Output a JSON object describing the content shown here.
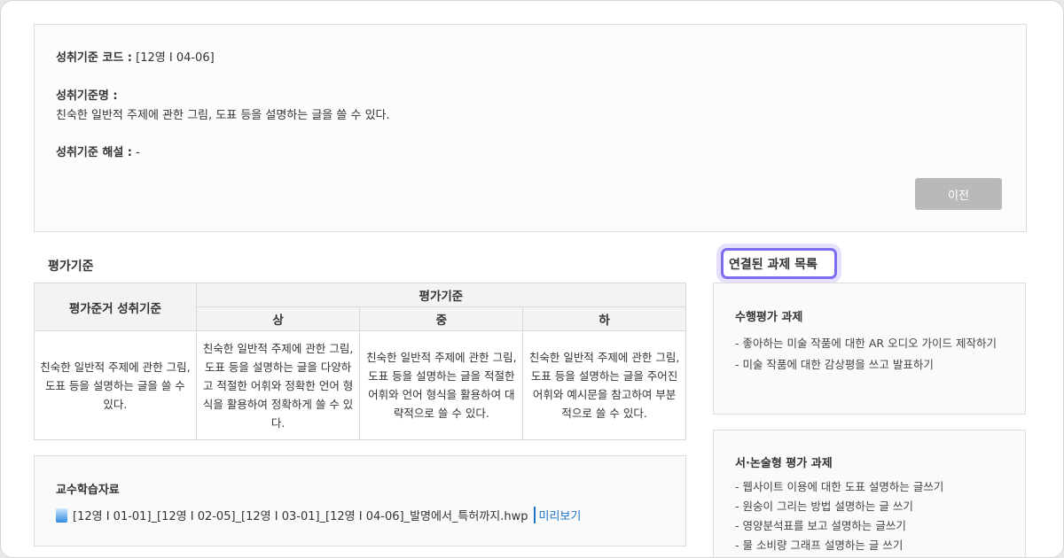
{
  "standard": {
    "code_label": "성취기준 코드 :",
    "code_value": "[12영 I 04-06]",
    "name_label": "성취기준명 :",
    "name_value": "친숙한 일반적 주제에 관한 그림, 도표 등을 설명하는 글을 쓸 수 있다.",
    "desc_label": "성취기준 해설 :",
    "desc_value": "-",
    "prev_button": "이전"
  },
  "criteria": {
    "heading": "평가기준",
    "col_basis": "평가준거 성취기준",
    "col_group": "평가기준",
    "levels": [
      "상",
      "중",
      "하"
    ],
    "row": [
      "친숙한 일반적 주제에 관한 그림, 도표 등을 설명하는 글을 쓸 수 있다.",
      "친숙한 일반적 주제에 관한 그림, 도표 등을 설명하는 글을 다양하고 적절한 어휘와 정확한 언어 형식을 활용하여 정확하게 쓸 수 있다.",
      "친숙한 일반적 주제에 관한 그림, 도표 등을 설명하는 글을 적절한 어휘와 언어 형식을 활용하여 대략적으로 쓸 수 있다.",
      "친숙한 일반적 주제에 관한 그림, 도표 등을 설명하는 글을 주어진 어휘와 예시문을 참고하여 부분적으로 쓸 수 있다."
    ]
  },
  "materials": {
    "heading": "교수학습자료",
    "file": "[12영 I 01-01]_[12영 I 02-05]_[12영 I 03-01]_[12영 I 04-06]_발명에서_특허까지.hwp",
    "preview": "미리보기"
  },
  "linked": {
    "heading": "연결된 과제 목록",
    "performance": {
      "title": "수행평가 과제",
      "items": [
        "- 좋아하는 미술 작품에 대한 AR 오디오 가이드 제작하기",
        "- 미술 작품에 대한 감상평을 쓰고 발표하기"
      ]
    },
    "essay": {
      "title": "서·논술형 평가 과제",
      "items": [
        "- 웹사이트 이용에 대한 도표 설명하는 글쓰기",
        "- 원숭이 그리는 방법 설명하는 글 쓰기",
        "- 영양분석표를 보고 설명하는 글쓰기",
        "- 물 소비량 그래프 설명하는 글 쓰기"
      ]
    }
  }
}
